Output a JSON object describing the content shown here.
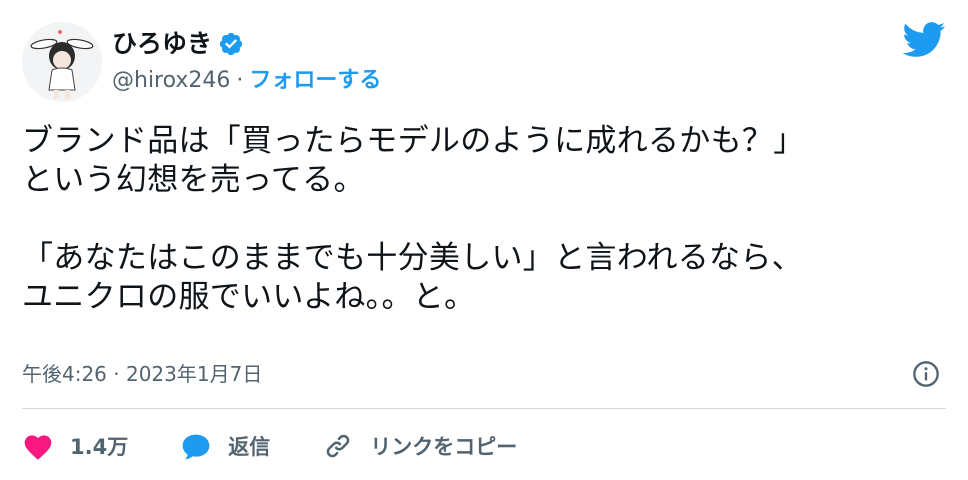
{
  "user": {
    "display_name": "ひろゆき",
    "handle": "@hirox246",
    "separator": "·",
    "follow_label": "フォローする"
  },
  "tweet": {
    "lines": [
      "ブランド品は「買ったらモデルのように成れるかも？」",
      "という幻想を売ってる。",
      "",
      "「あなたはこのままでも十分美しい」と言われるなら、",
      "ユニクロの服でいいよね。。と。"
    ],
    "timestamp": "午後4:26 · 2023年1月7日"
  },
  "actions": {
    "like_count": "1.4万",
    "reply_label": "返信",
    "copy_link_label": "リンクをコピー"
  },
  "colors": {
    "accent": "#1d9bf0",
    "like": "#f91880",
    "muted": "#536471",
    "text": "#0f1419"
  },
  "icons": [
    "verified-badge-icon",
    "twitter-bird-icon",
    "info-icon",
    "heart-icon",
    "reply-bubble-icon",
    "link-icon"
  ]
}
